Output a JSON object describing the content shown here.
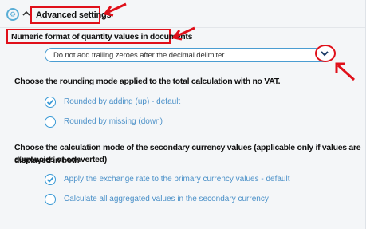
{
  "header": {
    "section_label": "Advanced settings",
    "icons": [
      "settings-gear-icon",
      "chevron-up-icon"
    ]
  },
  "numeric_format": {
    "label": "Numeric format of quantity values in documents",
    "selected_value": "Do not add trailing zeroes after the decimal delimiter",
    "dropdown_icon": "chevron-down-icon"
  },
  "rounding": {
    "title": "Choose the rounding mode applied to the total calculation with no VAT.",
    "options": [
      {
        "label": "Rounded by adding (up) - default",
        "checked": true
      },
      {
        "label": "Rounded by missing (down)",
        "checked": false
      }
    ]
  },
  "secondary_currency": {
    "title_line1": "Choose the calculation mode of the secondary currency values (applicable only if values are displayed in both",
    "title_line2": "currencies or converted)",
    "options": [
      {
        "label": "Apply the exchange rate to the primary currency values - default",
        "checked": true
      },
      {
        "label": "Calculate all aggregated values in the secondary currency",
        "checked": false
      }
    ]
  },
  "colors": {
    "highlight_red": "#e0101a",
    "accent_blue": "#3a9ad6",
    "panel_bg": "#f4f6f8"
  }
}
